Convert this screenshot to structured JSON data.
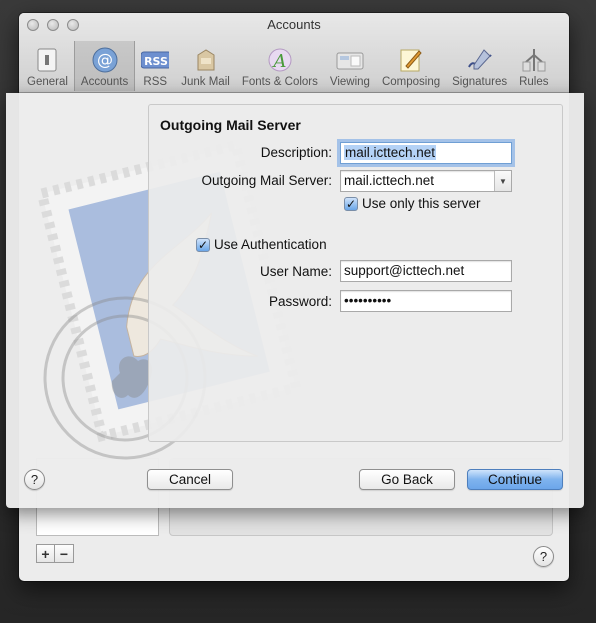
{
  "window": {
    "title": "Accounts",
    "toolbar": [
      {
        "label": "General",
        "icon": "general-icon"
      },
      {
        "label": "Accounts",
        "icon": "at-sign-icon",
        "active": true
      },
      {
        "label": "RSS",
        "icon": "rss-icon"
      },
      {
        "label": "Junk Mail",
        "icon": "junk-mail-icon"
      },
      {
        "label": "Fonts & Colors",
        "icon": "fonts-colors-icon"
      },
      {
        "label": "Viewing",
        "icon": "viewing-icon"
      },
      {
        "label": "Composing",
        "icon": "composing-icon"
      },
      {
        "label": "Signatures",
        "icon": "signatures-icon"
      },
      {
        "label": "Rules",
        "icon": "rules-icon"
      }
    ],
    "add_label": "+",
    "remove_label": "−",
    "help_label": "?"
  },
  "sheet": {
    "title": "Outgoing Mail Server",
    "description_label": "Description:",
    "description_value": "mail.icttech.net",
    "server_label": "Outgoing Mail Server:",
    "server_value": "mail.icttech.net",
    "use_only_label": "Use only this server",
    "use_only_checked": true,
    "use_auth_label": "Use Authentication",
    "use_auth_checked": true,
    "username_label": "User Name:",
    "username_value": "support@icttech.net",
    "password_label": "Password:",
    "password_value": "••••••••••",
    "help_label": "?",
    "cancel_label": "Cancel",
    "goback_label": "Go Back",
    "continue_label": "Continue",
    "colors": {
      "accent": "#6ca6ea",
      "focus_ring": "#69a0e6"
    }
  }
}
